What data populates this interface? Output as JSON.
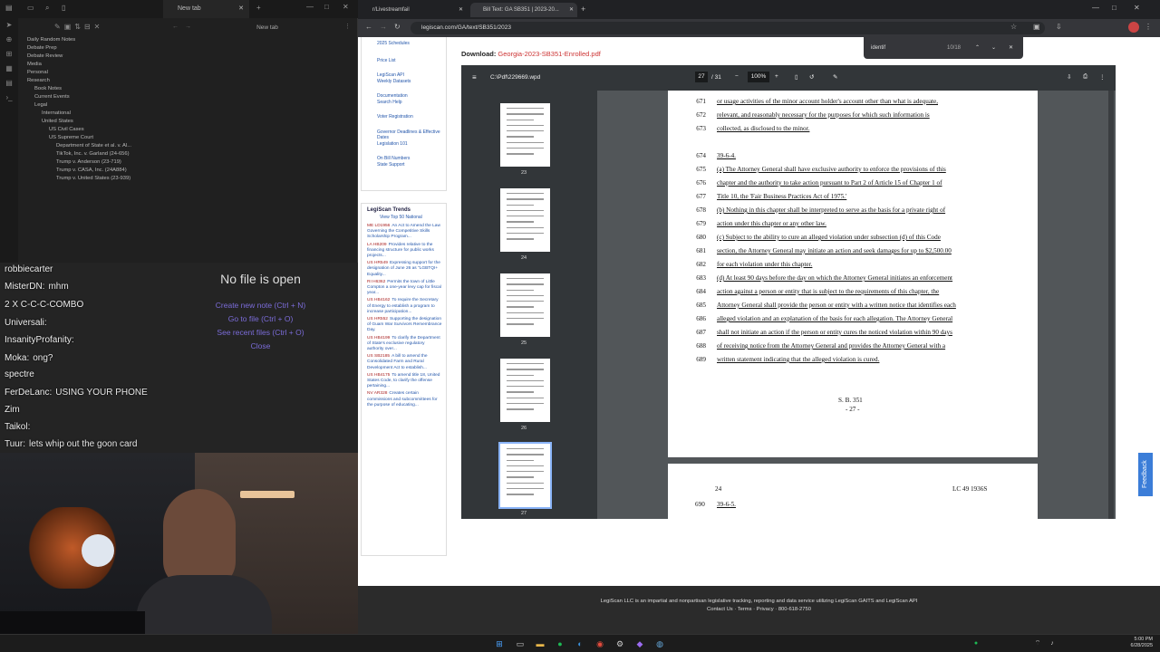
{
  "obsidian": {
    "tab_title": "New tab",
    "pane_title": "New tab",
    "tree": [
      {
        "label": "Daily Random Notes",
        "indent": 1
      },
      {
        "label": "Debate Prep",
        "indent": 1
      },
      {
        "label": "Debate Review",
        "indent": 1
      },
      {
        "label": "Media",
        "indent": 1
      },
      {
        "label": "Personal",
        "indent": 1
      },
      {
        "label": "Research",
        "indent": 1
      },
      {
        "label": "Book Notes",
        "indent": 2
      },
      {
        "label": "Current Events",
        "indent": 2
      },
      {
        "label": "Legal",
        "indent": 2
      },
      {
        "label": "International",
        "indent": 3
      },
      {
        "label": "United States",
        "indent": 3
      },
      {
        "label": "US Civil Cases",
        "indent": 4
      },
      {
        "label": "US Supreme Court",
        "indent": 4
      },
      {
        "label": "Department of State et al. v. Al...",
        "indent": 5
      },
      {
        "label": "TikTok, Inc. v. Garland (24-656)",
        "indent": 5
      },
      {
        "label": "Trump v. Anderson (23-719)",
        "indent": 5
      },
      {
        "label": "Trump v. CASA, Inc. (24A884)",
        "indent": 5
      },
      {
        "label": "Trump v. United States (23-939)",
        "indent": 5
      }
    ],
    "no_file": {
      "title": "No file is open",
      "create": "Create new note (Ctrl + N)",
      "goto": "Go to file (Ctrl + O)",
      "recent": "See recent files (Ctrl + O)",
      "close": "Close"
    }
  },
  "chat": [
    {
      "user": "robbiecarter",
      "msg": ""
    },
    {
      "user": "MisterDN:",
      "msg": "mhm"
    },
    {
      "user": "2 X C-C-C-COMBO",
      "msg": ""
    },
    {
      "user": "Universali:",
      "msg": ""
    },
    {
      "user": "InsanityProfanity:",
      "msg": ""
    },
    {
      "user": "Moka:",
      "msg": "ong?"
    },
    {
      "user": "spectre",
      "msg": ""
    },
    {
      "user": "FerDeLanc:",
      "msg": "USING YOUR PHONE"
    },
    {
      "user": "Zim",
      "msg": ""
    },
    {
      "user": "Taikol:",
      "msg": ""
    },
    {
      "user": "Tuur:",
      "msg": "lets whip out the goon card"
    }
  ],
  "browser": {
    "tabs": [
      {
        "label": "r/Livestreamfail"
      },
      {
        "label": "Bill Text: GA SB351 | 2023-20..."
      }
    ],
    "url": "legiscan.com/GA/text/SB351/2023",
    "find": {
      "query": "identif",
      "count": "10/18"
    }
  },
  "sidebar": {
    "links": [
      "2025 Schedules",
      "Price List",
      "LegiScan API",
      "Weekly Datasets",
      "Documentation",
      "Search Help",
      "Voter Registration",
      "Governor Deadlines & Effective Dates",
      "Legislation 101",
      "On Bill Numbers",
      "State Support"
    ],
    "trends_title": "LegiScan Trends",
    "trends_sub": "View Top 50 National",
    "trends": [
      {
        "id": "ME LD1956",
        "text": "An Act to Amend the Law Governing the Competitive Skills Scholarship Program..."
      },
      {
        "id": "LA HB209",
        "text": "Provides relative to the financing structure for public works projects..."
      },
      {
        "id": "US HR549",
        "text": "Expressing support for the designation of June 26 as \"LGBTQI+ Equality..."
      },
      {
        "id": "RI H6362",
        "text": "Permits the town of Little Compton a one-year levy cap for fiscal year..."
      },
      {
        "id": "US HB4162",
        "text": "To require the Secretary of Energy to establish a program to increase participation..."
      },
      {
        "id": "US HR552",
        "text": "Supporting the designation of Guam War Survivors Remembrance Day."
      },
      {
        "id": "US HB4199",
        "text": "To clarify the Department of State's exclusive regulatory authority over..."
      },
      {
        "id": "US SB2185",
        "text": "A bill to amend the Consolidated Farm and Rural Development Act to establish..."
      },
      {
        "id": "US HB4175",
        "text": "To amend title 18, United States Code, to clarify the offense pertaining..."
      },
      {
        "id": "NV AR328",
        "text": "Creates certain commissions and subcommittees for the purpose of educating..."
      }
    ]
  },
  "download": {
    "label": "Download:",
    "file": "Georgia-2023-SB351-Enrolled.pdf"
  },
  "pdf": {
    "filename": "C:\\Pdf\\229669.wpd",
    "page_current": "27",
    "page_total": "/ 31",
    "zoom": "100%",
    "thumb_pages": [
      "23",
      "24",
      "25",
      "26",
      "27"
    ],
    "lines": [
      {
        "no": "671",
        "text": "or usage activities of the minor account holder's account other than what is adequate,"
      },
      {
        "no": "672",
        "text": "relevant, and reasonably necessary for the purposes for which such information is"
      },
      {
        "no": "673",
        "text": "collected, as disclosed to the minor."
      },
      {
        "no": "674",
        "text": "39-6-4."
      },
      {
        "no": "675",
        "text": "(a)  The Attorney General shall have exclusive authority to enforce the provisions of this"
      },
      {
        "no": "676",
        "text": "chapter and the authority to take action pursuant to Part 2 of Article 15 of Chapter 1 of"
      },
      {
        "no": "677",
        "text": "Title 10, the 'Fair Business Practices Act of 1975.'"
      },
      {
        "no": "678",
        "text": "(b)  Nothing in this chapter shall be interpreted to serve as the basis for a private right of"
      },
      {
        "no": "679",
        "text": "action under this chapter or any other law."
      },
      {
        "no": "680",
        "text": "(c)  Subject to the ability to cure an alleged violation under subsection (d) of this Code"
      },
      {
        "no": "681",
        "text": "section, the Attorney General may initiate an action and seek damages for up to $2,500.00"
      },
      {
        "no": "682",
        "text": "for each violation under this chapter."
      },
      {
        "no": "683",
        "text": "(d)  At least 90 days before the day on which the Attorney General initiates an enforcement"
      },
      {
        "no": "684",
        "text": "action against a person or entity that is subject to the requirements of this chapter, the"
      },
      {
        "no": "685",
        "text": "Attorney General shall provide the person or entity with a written notice that identifies each"
      },
      {
        "no": "686",
        "text": "alleged violation and an explanation of the basis for each allegation.  The Attorney General"
      },
      {
        "no": "687",
        "text": "shall not initiate an action if the person or entity cures the noticed violation within 90 days"
      },
      {
        "no": "688",
        "text": "of receiving notice from the Attorney General and provides the Attorney General with a"
      },
      {
        "no": "689",
        "text": "written statement indicating that the alleged violation is cured."
      }
    ],
    "footer1": "S. B. 351",
    "footer2": "- 27 -",
    "next_page_num": "24",
    "next_page_code": "LC 49 1936S",
    "next_line_no": "690",
    "next_line_text": "39-6-5."
  },
  "site_footer": {
    "line1": "LegiScan LLC is an impartial and nonpartisan legislative tracking, reporting and data service utilizing LegiScan GAITS and LegiScan API",
    "line2": "Contact Us · Terms · Privacy · 800-618-2750"
  },
  "feedback": "Feedback",
  "clock": {
    "time": "5:00 PM",
    "date": "6/28/2025"
  }
}
